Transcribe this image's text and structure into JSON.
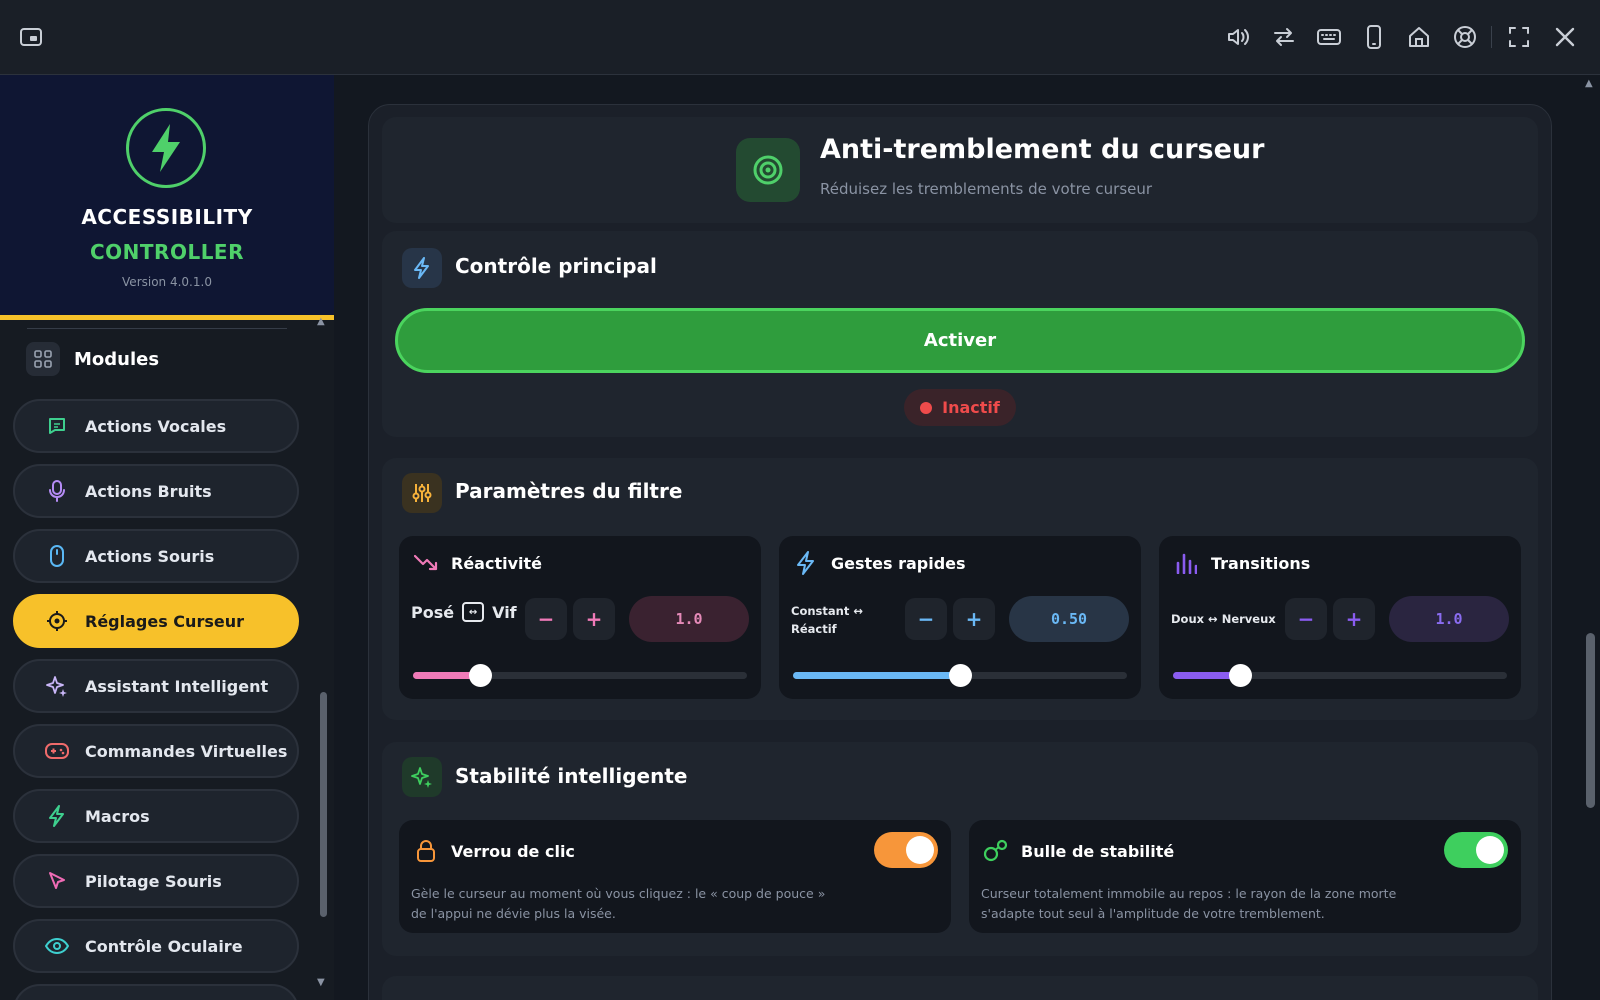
{
  "app": {
    "brand_line1": "ACCESSIBILITY",
    "brand_line2": "CONTROLLER",
    "version": "Version 4.0.1.0"
  },
  "topbar": {
    "left_icon": "picture-in-picture-icon",
    "right_icons": [
      "speaker-icon",
      "swap-arrows-icon",
      "keyboard-icon",
      "phone-icon",
      "home-icon",
      "lifebuoy-icon",
      "fullscreen-icon",
      "close-icon"
    ]
  },
  "sidebar": {
    "section_label": "Modules",
    "items": [
      {
        "label": "Actions Vocales",
        "icon": "chat-icon",
        "color": "#3ecf8e"
      },
      {
        "label": "Actions Bruits",
        "icon": "microphone-icon",
        "color": "#b58cf5"
      },
      {
        "label": "Actions Souris",
        "icon": "mouse-icon",
        "color": "#5ab8f5"
      },
      {
        "label": "Réglages Curseur",
        "icon": "crosshair-icon",
        "color": "#1a1a1a"
      },
      {
        "label": "Assistant Intelligent",
        "icon": "sparkle-icon",
        "color": "#c9b6f7"
      },
      {
        "label": "Commandes Virtuelles",
        "icon": "gamepad-icon",
        "color": "#f06b6b"
      },
      {
        "label": "Macros",
        "icon": "bolt-icon",
        "color": "#3ecf8e"
      },
      {
        "label": "Pilotage Souris",
        "icon": "cursor-arrow-icon",
        "color": "#f06bb5"
      },
      {
        "label": "Contrôle Oculaire",
        "icon": "eye-icon",
        "color": "#3ecfcf"
      }
    ],
    "active_index": 3
  },
  "header": {
    "title": "Anti-tremblement du curseur",
    "subtitle": "Réduisez les tremblements de votre curseur"
  },
  "main_control": {
    "title": "Contrôle principal",
    "activate_label": "Activer",
    "status": "Inactif"
  },
  "filter": {
    "title": "Paramètres du filtre",
    "panels": [
      {
        "title": "Réactivité",
        "range_left": "Posé",
        "range_right": "Vif",
        "value": "1.0",
        "level": 0.2,
        "accent": "#f07ab8",
        "value_bg": "#3a2230",
        "value_color": "#e58ab8"
      },
      {
        "title": "Gestes rapides",
        "range_line1": "Constant ↔",
        "range_line2": "Réactif",
        "value": "0.50",
        "level": 0.5,
        "accent": "#6ab8f5",
        "value_bg": "#283546",
        "value_color": "#6ab8f5"
      },
      {
        "title": "Transitions",
        "range_text": "Doux ↔ Nerveux",
        "value": "1.0",
        "level": 0.2,
        "accent": "#8a5cf0",
        "value_bg": "#2a2540",
        "value_color": "#8a6cf0"
      }
    ]
  },
  "stability": {
    "title": "Stabilité intelligente",
    "items": [
      {
        "title": "Verrou de clic",
        "desc_line1": "Gèle le curseur au moment où vous cliquez : le « coup de pouce »",
        "desc_line2": "de l'appui ne dévie plus la visée.",
        "enabled": true,
        "accent": "#f7963a"
      },
      {
        "title": "Bulle de stabilité",
        "desc_line1": "Curseur totalement immobile au repos : le rayon de la zone morte",
        "desc_line2": "s'adapte tout seul à l'amplitude de votre tremblement.",
        "enabled": true,
        "accent": "#3ecf5e"
      }
    ]
  }
}
